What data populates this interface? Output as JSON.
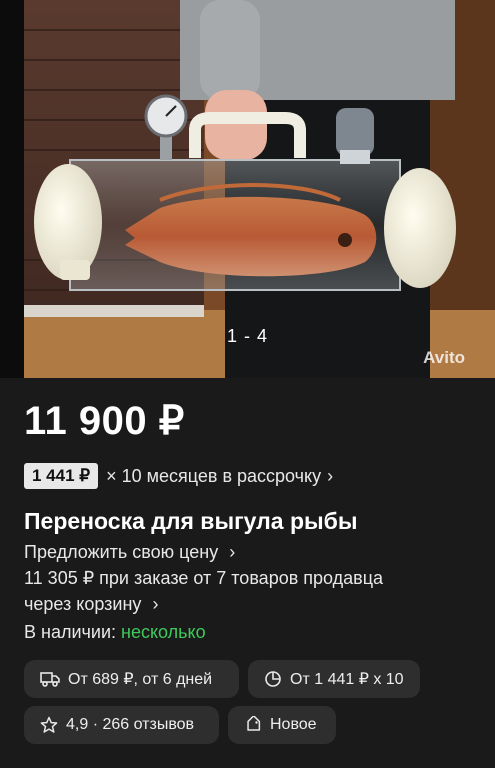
{
  "gallery": {
    "counter": "1 - 4",
    "watermark": "Avito"
  },
  "price": "11 900 ₽",
  "installment": {
    "badge": "1 441 ₽",
    "text": "× 10 месяцев в рассрочку",
    "chevron": "›"
  },
  "title": "Переноска для выгула рыбы",
  "offer": {
    "propose_price": "Предложить свою цену",
    "bulk_line1": "11 305 ₽ при заказе от 7 товаров продавца",
    "bulk_line2": "через корзину",
    "chevron": "›"
  },
  "availability": {
    "label": "В наличии:",
    "value": "несколько"
  },
  "chips": {
    "delivery": "От 689 ₽, от 6 дней",
    "installment": "От 1 441 ₽ x 10",
    "rating": "4,9 · 266 отзывов",
    "condition": "Новое"
  },
  "icons": {
    "delivery": "truck-icon",
    "installment": "pie-chart-icon",
    "rating": "star-icon",
    "condition": "tag-icon"
  },
  "colors": {
    "background": "#1a1a1a",
    "in_stock": "#3fc95b",
    "chip_bg": "#2e2e2e"
  }
}
